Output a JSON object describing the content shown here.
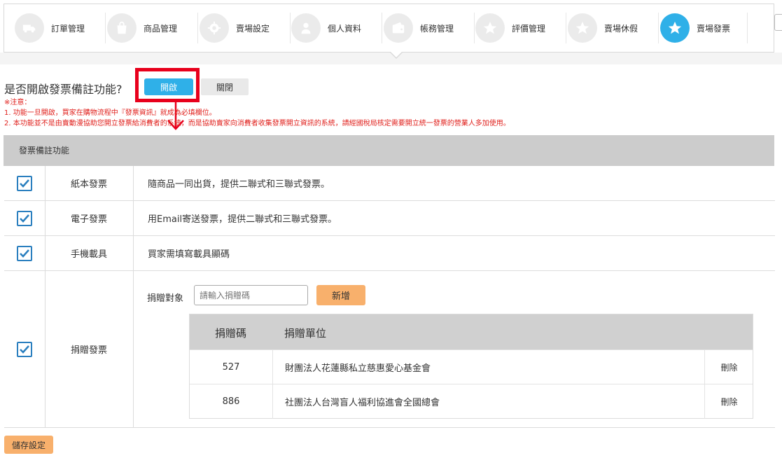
{
  "tabs": [
    {
      "label": "訂單管理",
      "icon": "truck-icon",
      "active": false
    },
    {
      "label": "商品管理",
      "icon": "bag-icon",
      "active": false
    },
    {
      "label": "賣場設定",
      "icon": "gear-icon",
      "active": false
    },
    {
      "label": "個人資料",
      "icon": "user-icon",
      "active": false
    },
    {
      "label": "帳務管理",
      "icon": "wallet-icon",
      "active": false
    },
    {
      "label": "評價管理",
      "icon": "star-icon",
      "active": false
    },
    {
      "label": "賣場休假",
      "icon": "star-icon",
      "active": false
    },
    {
      "label": "賣場發票",
      "icon": "star-icon",
      "active": true
    }
  ],
  "toggle": {
    "question": "是否開啟發票備註功能?",
    "on_label": "開啟",
    "off_label": "關閉"
  },
  "notes": {
    "title": "※注意：",
    "line1": "1. 功能一旦開啟，買家在購物流程中『發票資訊』就成為必填欄位。",
    "line2": "2. 本功能並不是由賣動漫協助您開立發票給消費者的系統，而是協助賣家向消費者收集發票開立資訊的系統，請經國稅局核定需要開立統一發票的營業人多加使用。"
  },
  "table": {
    "header": "發票備註功能",
    "rows": [
      {
        "name": "紙本發票",
        "desc": "隨商品一同出貨，提供二聯式和三聯式發票。",
        "checked": true
      },
      {
        "name": "電子發票",
        "desc": "用Email寄送發票，提供二聯式和三聯式發票。",
        "checked": true
      },
      {
        "name": "手機載具",
        "desc": "買家需填寫載具顯碼",
        "checked": true
      },
      {
        "name": "捐贈發票",
        "desc": "",
        "checked": true
      }
    ]
  },
  "donate": {
    "label": "捐贈對象",
    "placeholder": "請輸入捐贈碼",
    "add_label": "新增",
    "col_code": "捐贈碼",
    "col_unit": "捐贈單位",
    "items": [
      {
        "code": "527",
        "unit": "財團法人花蓮縣私立慈惠愛心基金會",
        "delete": "刪除"
      },
      {
        "code": "886",
        "unit": "社團法人台灣盲人福利協進會全國總會",
        "delete": "刪除"
      }
    ]
  },
  "save_label": "儲存設定",
  "colors": {
    "accent": "#2fb0e8",
    "highlight": "#e8001c",
    "orange": "#f8b06c",
    "note": "#e0201c"
  }
}
